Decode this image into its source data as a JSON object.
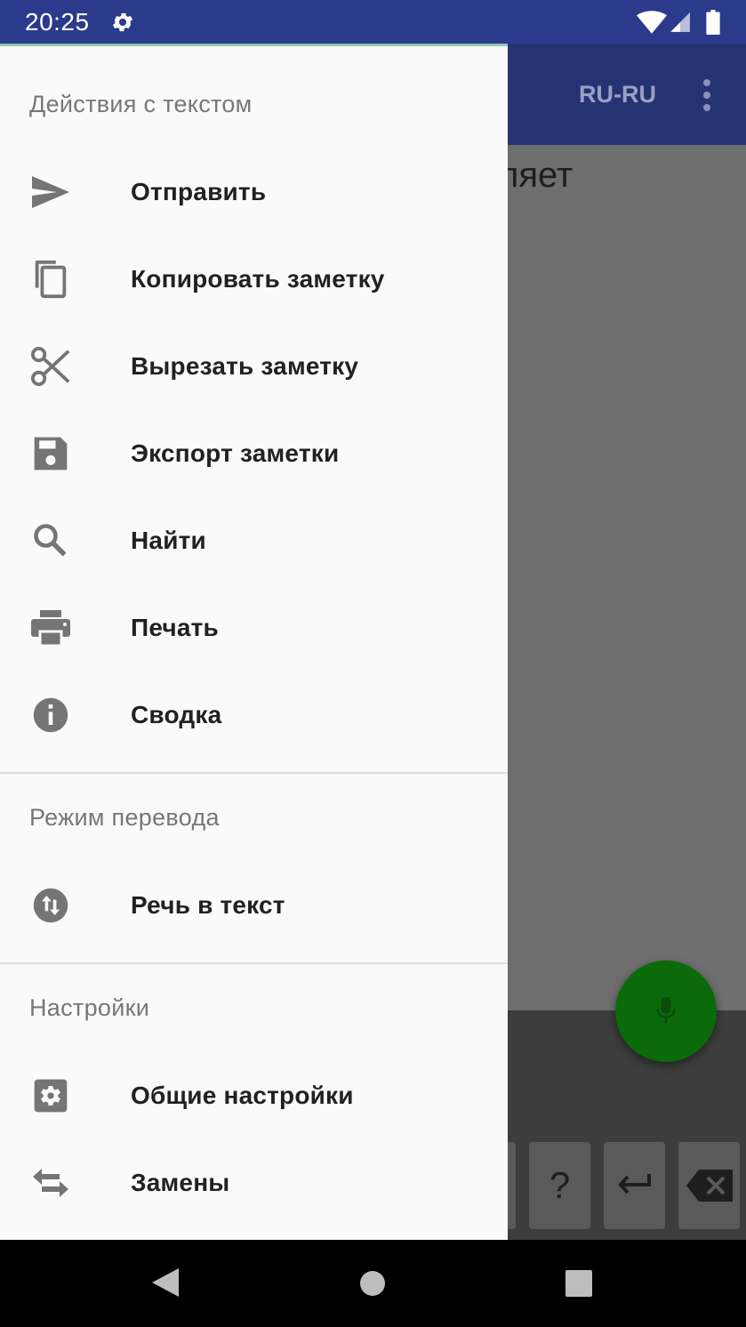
{
  "status_bar": {
    "time": "20:25",
    "icons": [
      "gear-icon",
      "wifi-icon",
      "signal-icon",
      "battery-icon"
    ]
  },
  "app_bar": {
    "language": "RU-RU",
    "overflow_icon": "more-vert-icon"
  },
  "editor": {
    "visible_text": "ляет"
  },
  "keyboard": {
    "keys": [
      "?",
      "enter-icon",
      "backspace-icon"
    ]
  },
  "fab": {
    "icon": "mic-icon",
    "color": "#0b6b0b"
  },
  "drawer": {
    "sections": [
      {
        "title": "Действия с текстом",
        "items": [
          {
            "label": "Отправить",
            "icon": "send-icon"
          },
          {
            "label": "Копировать заметку",
            "icon": "copy-icon"
          },
          {
            "label": "Вырезать заметку",
            "icon": "scissors-icon"
          },
          {
            "label": "Экспорт заметки",
            "icon": "save-icon"
          },
          {
            "label": "Найти",
            "icon": "search-icon"
          },
          {
            "label": "Печать",
            "icon": "print-icon"
          },
          {
            "label": "Сводка",
            "icon": "info-icon"
          }
        ]
      },
      {
        "title": "Режим перевода",
        "items": [
          {
            "label": "Речь в текст",
            "icon": "swap-vert-icon"
          }
        ]
      },
      {
        "title": "Настройки",
        "items": [
          {
            "label": "Общие настройки",
            "icon": "settings-icon"
          },
          {
            "label": "Замены",
            "icon": "swap-horiz-icon"
          }
        ]
      }
    ]
  },
  "nav_bar": {
    "icons": [
      "back-icon",
      "home-icon",
      "recents-icon"
    ]
  },
  "colors": {
    "status_bar": "#2c3a8c",
    "app_bar": "#263373",
    "drawer_bg": "#fafafa",
    "scrim": "#6b6b6b"
  }
}
